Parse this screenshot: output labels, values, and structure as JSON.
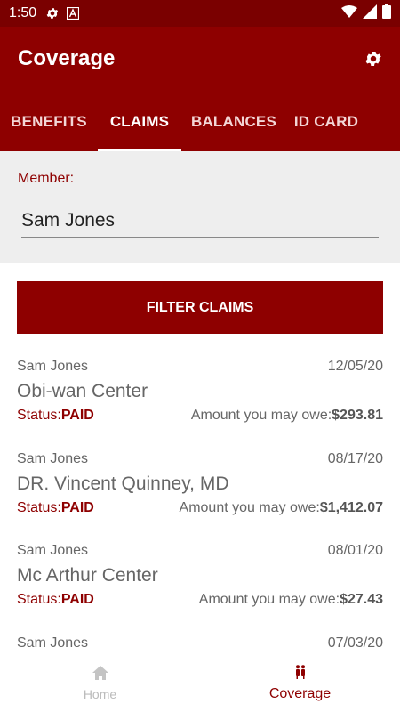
{
  "status_bar": {
    "time": "1:50"
  },
  "header": {
    "title": "Coverage"
  },
  "tabs": [
    {
      "label": "BENEFITS"
    },
    {
      "label": "CLAIMS",
      "active": true
    },
    {
      "label": "BALANCES"
    },
    {
      "label": "ID CARD"
    }
  ],
  "member": {
    "label": "Member:",
    "value": "Sam Jones"
  },
  "filter": {
    "label": "FILTER CLAIMS"
  },
  "claims": [
    {
      "member": "Sam Jones",
      "date": "12/05/20",
      "provider": "Obi-wan Center",
      "status_label": "Status:",
      "status": "PAID",
      "amount_label": "Amount you may owe:",
      "amount": "$293.81"
    },
    {
      "member": "Sam Jones",
      "date": "08/17/20",
      "provider": "DR. Vincent Quinney, MD",
      "status_label": "Status:",
      "status": "PAID",
      "amount_label": "Amount you may owe:",
      "amount": "$1,412.07"
    },
    {
      "member": "Sam Jones",
      "date": "08/01/20",
      "provider": "Mc Arthur Center",
      "status_label": "Status:",
      "status": "PAID",
      "amount_label": "Amount you may owe:",
      "amount": "$27.43"
    },
    {
      "member": "Sam Jones",
      "date": "07/03/20"
    }
  ],
  "bottom_nav": {
    "home": {
      "label": "Home",
      "icon": "home-icon"
    },
    "coverage": {
      "label": "Coverage",
      "icon": "family-icon",
      "active": true
    }
  },
  "colors": {
    "primary": "#8e0000",
    "status_bar": "#7a0000",
    "panel": "#eeeeee"
  }
}
